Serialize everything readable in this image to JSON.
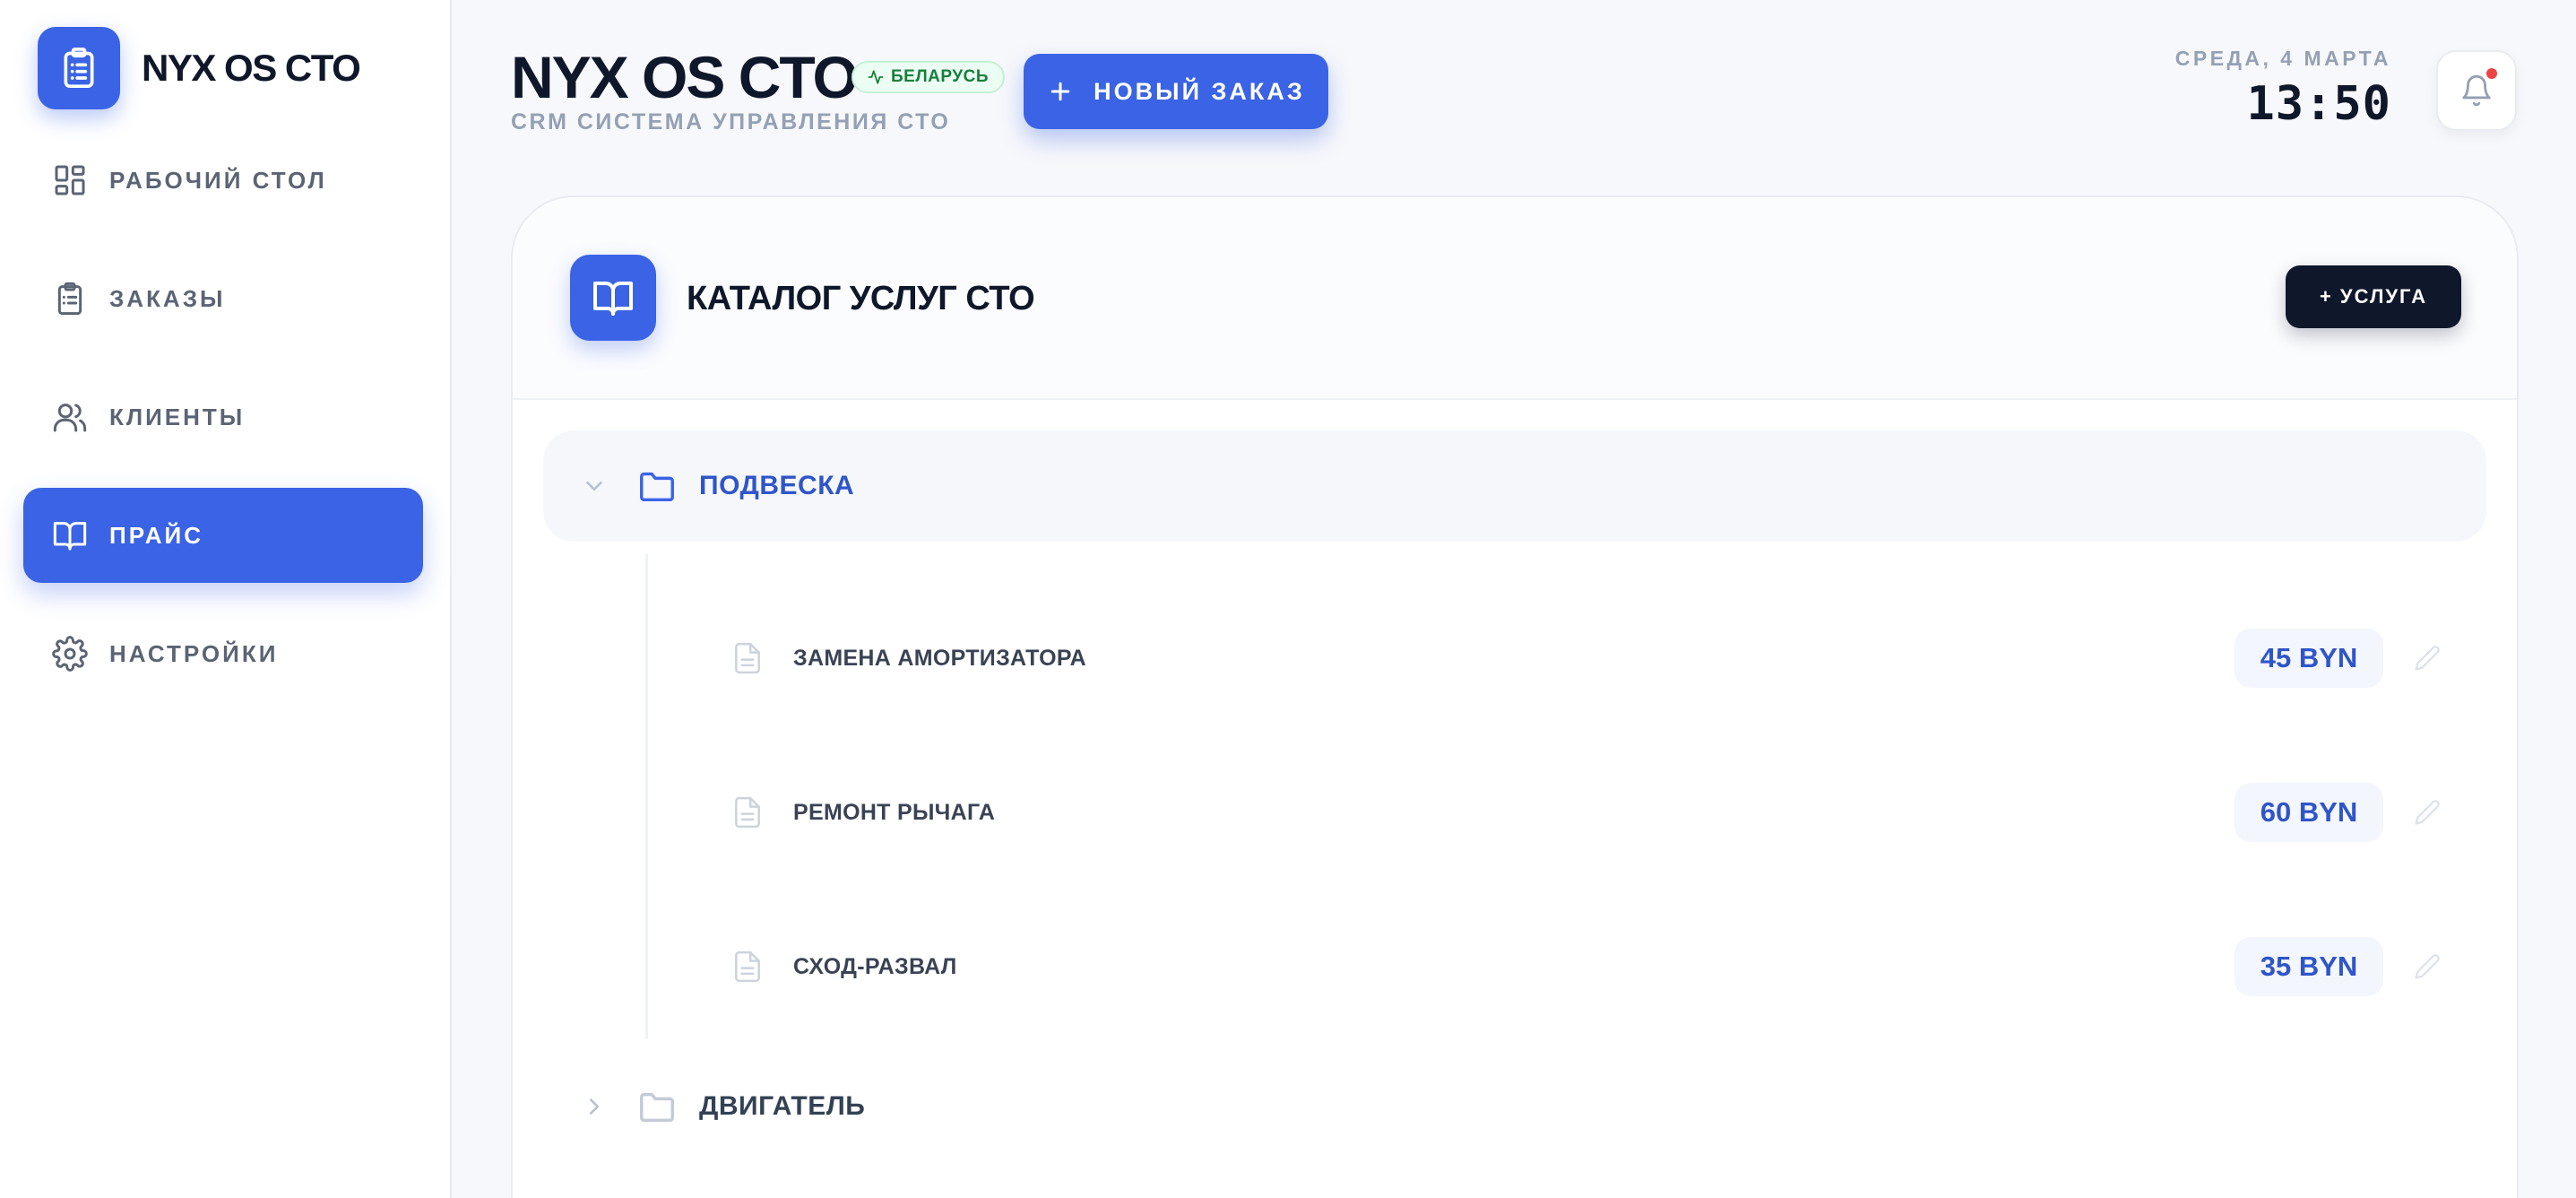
{
  "brand": {
    "name": "NYX OS CTO"
  },
  "sidebar": {
    "items": [
      {
        "label": "РАБОЧИЙ СТОЛ",
        "icon": "dashboard-icon",
        "active": false
      },
      {
        "label": "ЗАКАЗЫ",
        "icon": "clipboard-icon",
        "active": false
      },
      {
        "label": "КЛИЕНТЫ",
        "icon": "users-icon",
        "active": false
      },
      {
        "label": "ПРАЙС",
        "icon": "book-icon",
        "active": true
      },
      {
        "label": "НАСТРОЙКИ",
        "icon": "gear-icon",
        "active": false
      }
    ]
  },
  "header": {
    "title": "NYX OS CTO",
    "region": "БЕЛАРУСЬ",
    "subtitle": "CRM СИСТЕМА УПРАВЛЕНИЯ СТО",
    "new_order_label": "НОВЫЙ ЗАКАЗ",
    "date": "СРЕДА, 4 МАРТА",
    "time": "13:50"
  },
  "catalog": {
    "title": "КАТАЛОГ УСЛУГ СТО",
    "add_label": "+ УСЛУГА",
    "categories": [
      {
        "name": "ПОДВЕСКА",
        "expanded": true,
        "services": [
          {
            "name": "ЗАМЕНА АМОРТИЗАТОРА",
            "price": "45 BYN"
          },
          {
            "name": "РЕМОНТ РЫЧАГА",
            "price": "60 BYN"
          },
          {
            "name": "СХОД-РАЗВАЛ",
            "price": "35 BYN"
          }
        ]
      },
      {
        "name": "ДВИГАТЕЛЬ",
        "expanded": false,
        "services": []
      }
    ]
  },
  "colors": {
    "accent": "#3b63e6",
    "dark": "#0f172a",
    "notification": "#ef4444",
    "region_badge": "#15803d"
  }
}
